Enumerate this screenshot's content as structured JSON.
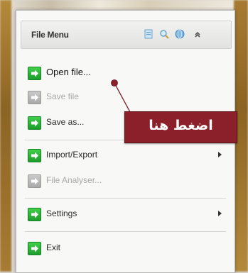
{
  "panel": {
    "title": "File Menu"
  },
  "header_icons": [
    "document-icon",
    "search-icon",
    "globe-icon",
    "collapse-arrow-icon"
  ],
  "menu": {
    "items": [
      {
        "label": "Open file...",
        "enabled": true,
        "icon": "green-arrow-icon"
      },
      {
        "label": "Save file",
        "enabled": false,
        "icon": "gray-arrow-icon"
      },
      {
        "label": "Save as...",
        "enabled": true,
        "icon": "green-arrow-icon"
      },
      {
        "label": "Import/Export",
        "enabled": true,
        "icon": "green-arrow-icon",
        "submenu": true
      },
      {
        "label": "File Analyser...",
        "enabled": false,
        "icon": "gray-arrow-icon"
      },
      {
        "label": "Settings",
        "enabled": true,
        "icon": "green-arrow-icon",
        "submenu": true
      },
      {
        "label": "Exit",
        "enabled": true,
        "icon": "green-arrow-icon"
      }
    ]
  },
  "callout": {
    "text": "اضغط هنا",
    "color": "#8b1f2a"
  }
}
